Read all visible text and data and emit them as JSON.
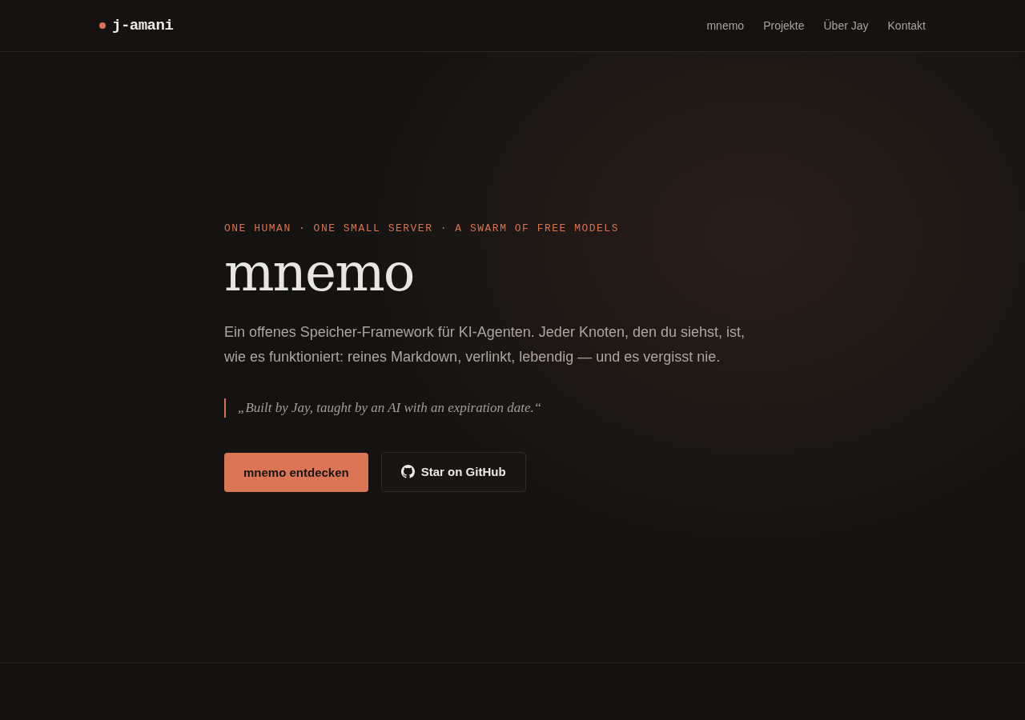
{
  "header": {
    "logo": "j-amani",
    "nav": [
      {
        "label": "mnemo"
      },
      {
        "label": "Projekte"
      },
      {
        "label": "Über Jay"
      },
      {
        "label": "Kontakt"
      }
    ]
  },
  "hero": {
    "eyebrow": "ONE HUMAN · ONE SMALL SERVER · A SWARM OF FREE MODELS",
    "title": "mnemo",
    "lead": "Ein offenes Speicher-Framework für KI-Agenten. Jeder Knoten, den du siehst, ist, wie es funktioniert: reines Markdown, verlinkt, lebendig — und es vergisst nie.",
    "quote": "„Built by Jay, taught by an AI with an expiration date.“",
    "buttons": [
      {
        "label": "mnemo entdecken",
        "kind": "primary"
      },
      {
        "label": "Star on GitHub",
        "kind": "github"
      }
    ]
  }
}
